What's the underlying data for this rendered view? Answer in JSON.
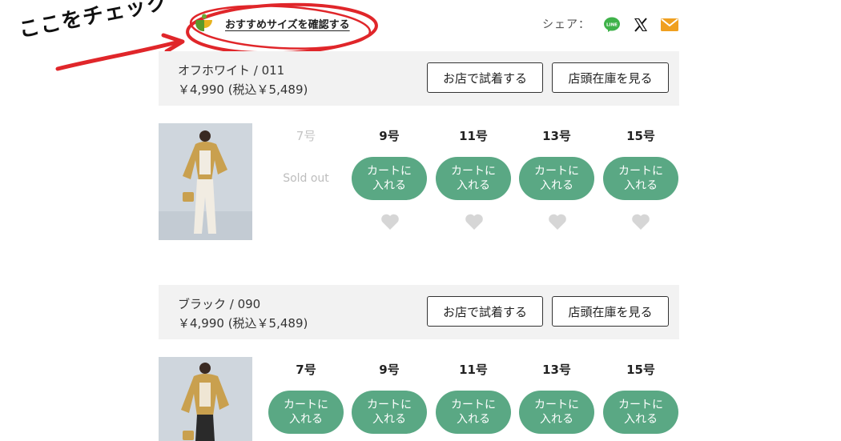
{
  "annotation": {
    "text": "ここをチェック"
  },
  "top": {
    "recommend_link": "おすすめサイズを確認する",
    "share_label": "シェア：",
    "share_icons": [
      "line-icon",
      "x-icon",
      "mail-icon"
    ]
  },
  "colors": [
    {
      "name": "オフホワイト / 011",
      "price": "￥4,990 (税込￥5,489)",
      "try_button": "お店で試着する",
      "stock_button": "店頭在庫を見る",
      "sizes": [
        {
          "label": "7号",
          "status": "Sold out"
        },
        {
          "label": "9号",
          "cart": "カートに\n入れる"
        },
        {
          "label": "11号",
          "cart": "カートに\n入れる"
        },
        {
          "label": "13号",
          "cart": "カートに\n入れる"
        },
        {
          "label": "15号",
          "cart": "カートに\n入れる"
        }
      ]
    },
    {
      "name": "ブラック / 090",
      "price": "￥4,990 (税込￥5,489)",
      "try_button": "お店で試着する",
      "stock_button": "店頭在庫を見る",
      "sizes": [
        {
          "label": "7号",
          "cart": "カートに\n入れる"
        },
        {
          "label": "9号",
          "cart": "カートに\n入れる"
        },
        {
          "label": "11号",
          "cart": "カートに\n入れる"
        },
        {
          "label": "13号",
          "cart": "カートに\n入れる"
        },
        {
          "label": "15号",
          "cart": "カートに\n入れる"
        }
      ]
    }
  ],
  "theme": {
    "accent_green": "#5aa884",
    "annotation_red": "#e0262a",
    "mail_orange": "#f0a020",
    "line_green": "#3fb24a"
  }
}
